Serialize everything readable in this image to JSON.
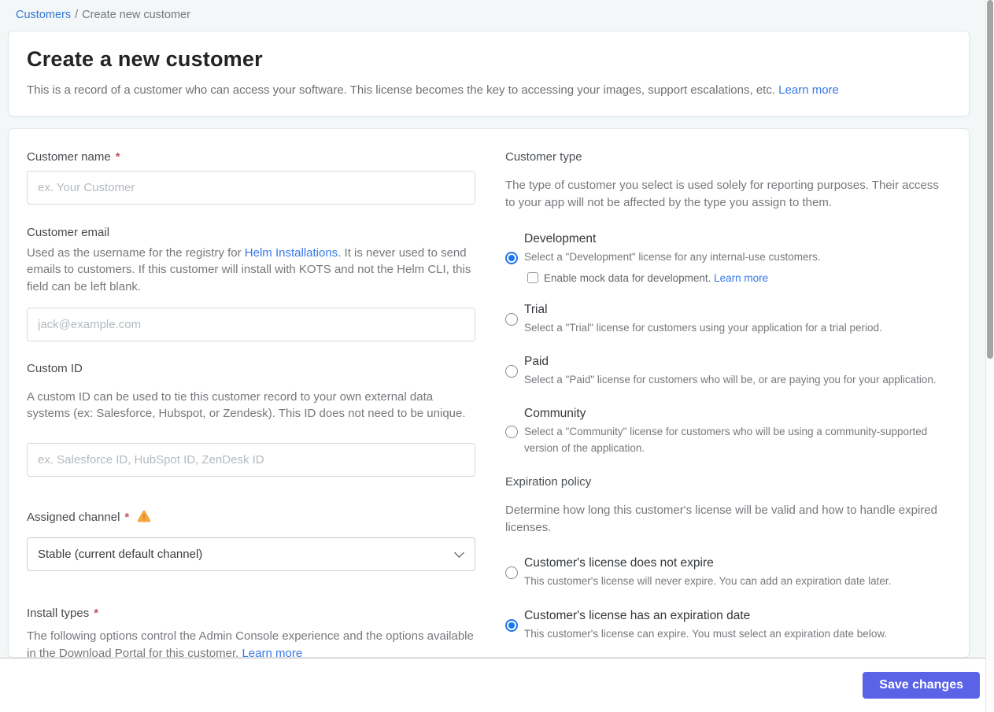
{
  "breadcrumb": {
    "link": "Customers",
    "separator": "/",
    "current": "Create new customer"
  },
  "header": {
    "title": "Create a new customer",
    "description": "This is a record of a customer who can access your software. This license becomes the key to accessing your images, support escalations, etc. ",
    "learn_more": "Learn more"
  },
  "form": {
    "customer_name": {
      "label": "Customer name",
      "required_mark": "*",
      "placeholder": "ex. Your Customer"
    },
    "customer_email": {
      "label": "Customer email",
      "desc_before": "Used as the username for the registry for ",
      "desc_link": "Helm Installations",
      "desc_after": ". It is never used to send emails to customers. If this customer will install with KOTS and not the Helm CLI, this field can be left blank.",
      "placeholder": "jack@example.com"
    },
    "custom_id": {
      "label": "Custom ID",
      "description": "A custom ID can be used to tie this customer record to your own external data systems (ex: Salesforce, Hubspot, or Zendesk). This ID does not need to be unique.",
      "placeholder": "ex. Salesforce ID, HubSpot ID, ZenDesk ID"
    },
    "assigned_channel": {
      "label": "Assigned channel",
      "required_mark": "*",
      "selected_option": "Stable (current default channel)"
    },
    "install_types": {
      "label": "Install types",
      "required_mark": "*",
      "desc_before": "The following options control the Admin Console experience and the options available in the Download Portal for this customer. ",
      "desc_link": "Learn more"
    }
  },
  "customer_type": {
    "heading": "Customer type",
    "intro": "The type of customer you select is used solely for reporting purposes. Their access to your app will not be affected by the type you assign to them.",
    "options": [
      {
        "title": "Development",
        "description": "Select a \"Development\" license for any internal-use customers.",
        "selected": true,
        "mock_checkbox": {
          "label": "Enable mock data for development. ",
          "link": "Learn more",
          "checked": false
        }
      },
      {
        "title": "Trial",
        "description": "Select a \"Trial\" license for customers using your application for a trial period.",
        "selected": false
      },
      {
        "title": "Paid",
        "description": "Select a \"Paid\" license for customers who will be, or are paying you for your application.",
        "selected": false
      },
      {
        "title": "Community",
        "description": "Select a \"Community\" license for customers who will be using a community-supported version of the application.",
        "selected": false
      }
    ]
  },
  "expiration_policy": {
    "heading": "Expiration policy",
    "intro": "Determine how long this customer's license will be valid and how to handle expired licenses.",
    "options": [
      {
        "title": "Customer's license does not expire",
        "description": "This customer's license will never expire. You can add an expiration date later.",
        "selected": false
      },
      {
        "title": "Customer's license has an expiration date",
        "description": "This customer's license can expire. You must select an expiration date below.",
        "selected": true
      }
    ]
  },
  "footer": {
    "save_button": "Save changes"
  },
  "colors": {
    "page_background": "#f3f7f8",
    "accent_radio_blue": "#1d74f0",
    "link_blue": "#3579e8",
    "primary_button": "#5a63e6",
    "warning_orange": "#f6a73c",
    "required_red": "#bf5560"
  }
}
